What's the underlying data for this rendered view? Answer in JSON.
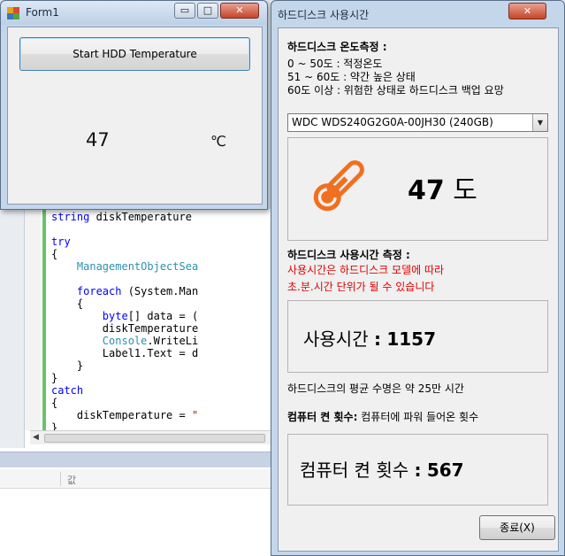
{
  "form1": {
    "title": "Form1",
    "minimize": "▭",
    "maximize": "□",
    "close": "✕",
    "start_button": "Start HDD Temperature",
    "temperature": "47",
    "unit": "℃"
  },
  "code_lines": [
    [
      {
        "t": "string ",
        "c": "kw"
      },
      {
        "t": "diskTemperature",
        "c": ""
      }
    ],
    [
      {
        "t": "",
        "c": ""
      }
    ],
    [
      {
        "t": "try",
        "c": "kw"
      }
    ],
    [
      {
        "t": "{",
        "c": ""
      }
    ],
    [
      {
        "t": "    ManagementObjectSea",
        "c": "ty"
      }
    ],
    [
      {
        "t": "",
        "c": ""
      }
    ],
    [
      {
        "t": "    foreach ",
        "c": "kw"
      },
      {
        "t": "(System.Man",
        "c": ""
      }
    ],
    [
      {
        "t": "    {",
        "c": ""
      }
    ],
    [
      {
        "t": "        byte",
        "c": "kw"
      },
      {
        "t": "[] data = (",
        "c": ""
      }
    ],
    [
      {
        "t": "        diskTemperature",
        "c": ""
      }
    ],
    [
      {
        "t": "        Console",
        "c": "ty"
      },
      {
        "t": ".WriteLi",
        "c": ""
      }
    ],
    [
      {
        "t": "        Label1.Text = d",
        "c": ""
      }
    ],
    [
      {
        "t": "    }",
        "c": ""
      }
    ],
    [
      {
        "t": "}",
        "c": ""
      }
    ],
    [
      {
        "t": "catch",
        "c": "kw"
      }
    ],
    [
      {
        "t": "{",
        "c": ""
      }
    ],
    [
      {
        "t": "    diskTemperature = ",
        "c": ""
      },
      {
        "t": "\"",
        "c": "st"
      }
    ],
    [
      {
        "t": "}",
        "c": ""
      }
    ]
  ],
  "ide": {
    "scroll_left": "◀",
    "props_header": "값"
  },
  "dialog": {
    "title": "하드디스크 사용시간",
    "close": "✕",
    "temp_header": "하드디스크 온도측정 :",
    "temp_ranges": [
      "0  ~ 50도 : 적정온도",
      "51 ~ 60도 : 약간 높은 상태",
      "60도 이상 : 위험한 상태로 하드디스크 백업 요망"
    ],
    "drive_selected": "WDC WDS240G2G0A-00JH30 (240GB)",
    "combo_arrow": "▼",
    "temperature_value": "47",
    "temperature_unit": "도",
    "usage_header": "하드디스크 사용시간 측정 :",
    "usage_note_1": "사용시간은 하드디스크 모델에 따라",
    "usage_note_2": "초.분.시간 단위가 될 수 있습니다",
    "usage_label": "사용시간",
    "usage_value": "1157",
    "avg_life": "하드디스크의 평균 수명은 약 25만 시간",
    "power_header_bold": "컴퓨터 켠 횟수:",
    "power_header_desc": "컴퓨터에 파워 들어온 횟수",
    "power_label": "컴퓨터 켠 횟수",
    "power_value": "567",
    "exit_button": "종료(X)"
  },
  "colors": {
    "thermometer": "#f07020",
    "window_frame": "#c4d6ea",
    "note_red": "#e00000"
  }
}
